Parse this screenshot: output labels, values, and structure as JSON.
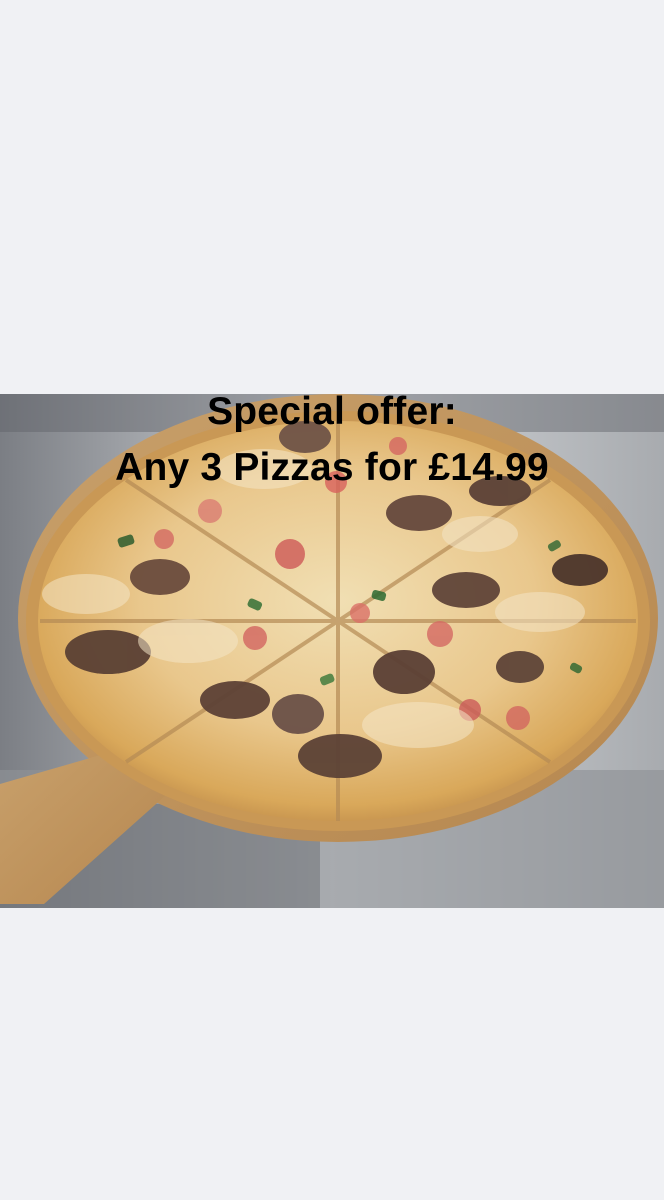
{
  "promo": {
    "headline": "Special offer:",
    "offer": "Any 3 Pizzas for £14.99"
  },
  "colors": {
    "background": "#f0f1f4",
    "text": "#000000"
  }
}
